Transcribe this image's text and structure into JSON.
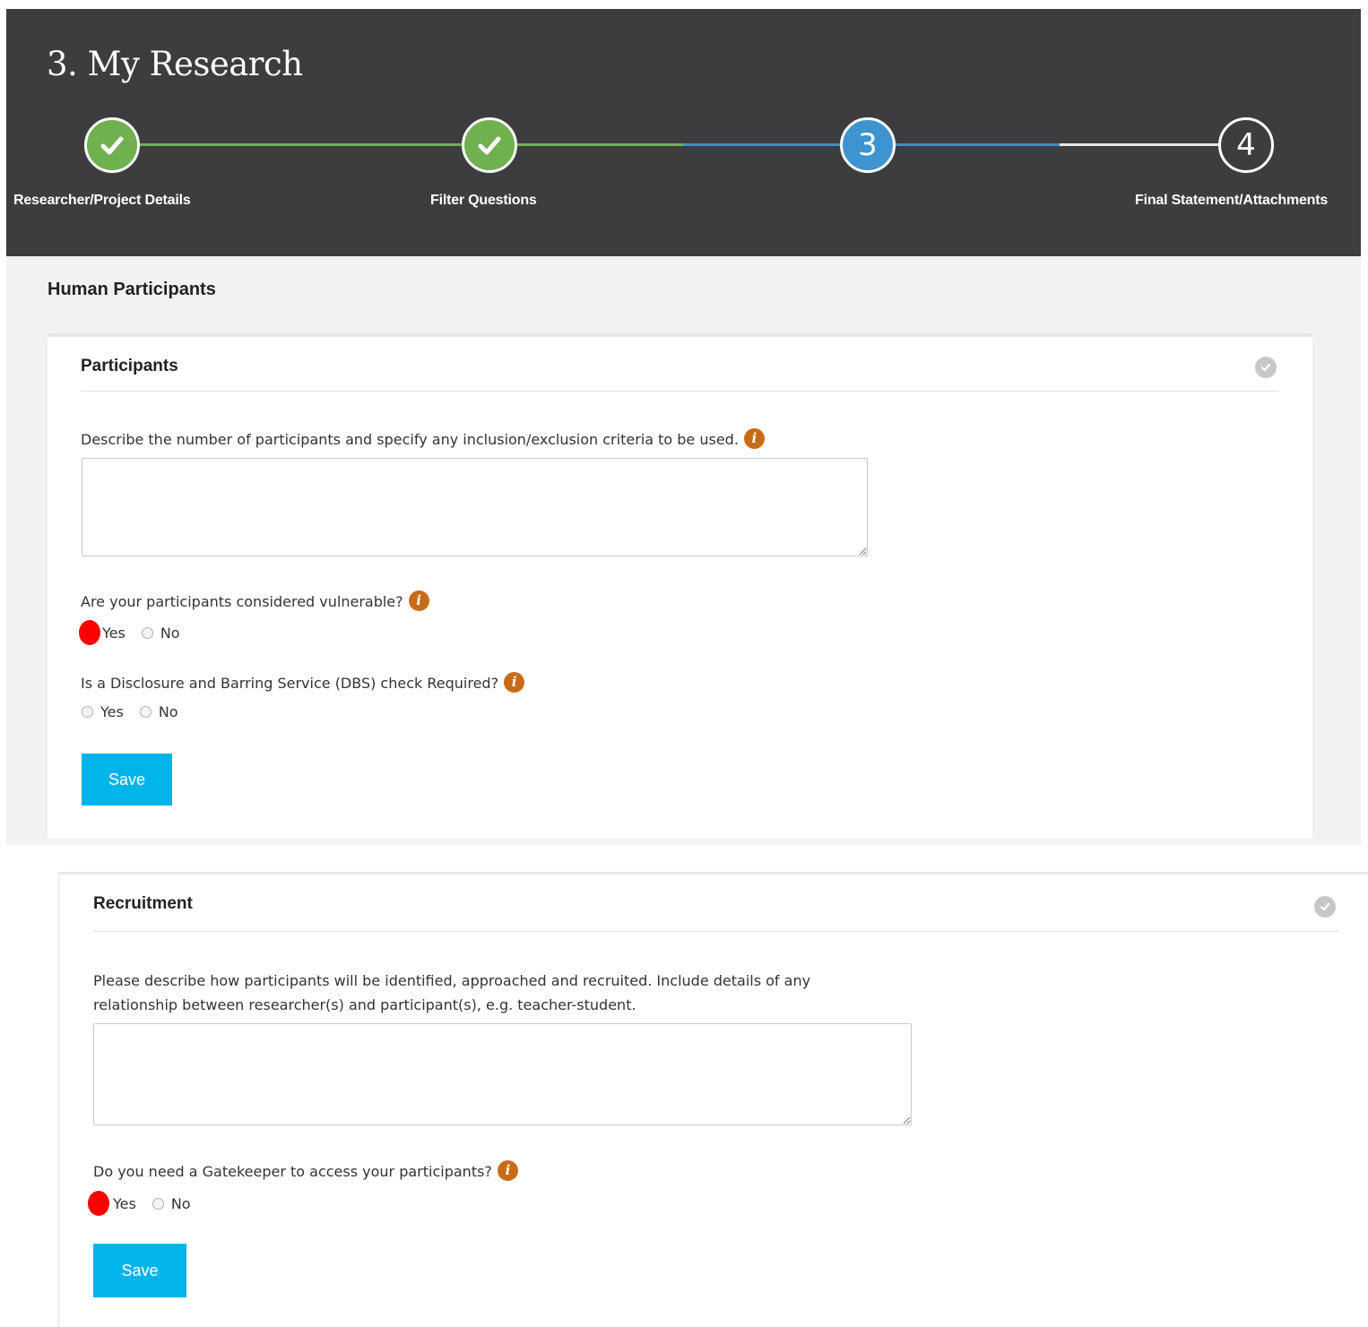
{
  "page": {
    "title": "3. My Research"
  },
  "stepper": {
    "steps": [
      {
        "number": "1",
        "label": "Researcher/Project Details",
        "state": "done"
      },
      {
        "number": "2",
        "label": "Filter Questions",
        "state": "done"
      },
      {
        "number": "3",
        "label": "",
        "state": "active"
      },
      {
        "number": "4",
        "label": "Final Statement/Attachments",
        "state": "todo"
      }
    ],
    "colors": {
      "done": "#6fb04f",
      "active": "#3d94d1",
      "todo": "#3d3d3f"
    }
  },
  "section": {
    "title": "Human Participants"
  },
  "participants": {
    "title": "Participants",
    "q1": "Describe the number of participants and specify any inclusion/exclusion criteria to be used.",
    "q1_value": "",
    "q2": "Are your participants considered vulnerable?",
    "q2_options": [
      "Yes",
      "No"
    ],
    "q3": "Is a Disclosure and Barring Service (DBS) check Required?",
    "q3_options": [
      "Yes",
      "No"
    ],
    "save_label": "Save"
  },
  "recruitment": {
    "title": "Recruitment",
    "q1_line1": "Please describe how participants will be identified, approached and recruited. Include details of any",
    "q1_line2": "relationship between researcher(s) and participant(s), e.g. teacher-student.",
    "q1_value": "",
    "q2": "Do you need a Gatekeeper to access your participants?",
    "q2_options": [
      "Yes",
      "No"
    ],
    "save_label": "Save"
  },
  "icons": {
    "info": "info-icon",
    "status": "check-circle-icon",
    "step_done": "checkmark-icon"
  },
  "accent": {
    "button": "#00b4ea",
    "info": "#c86b17",
    "annotation_marker": "#ff0000"
  }
}
